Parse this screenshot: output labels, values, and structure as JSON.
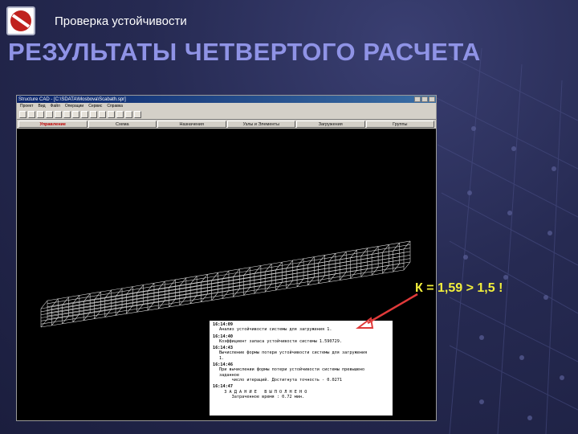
{
  "header": {
    "subtitle": "Проверка устойчивости",
    "title": "РЕЗУЛЬТАТЫ ЧЕТВЕРТОГО РАСЧЕТА"
  },
  "app": {
    "title": "Structure CAD - [C:\\SDATA\\Mosbova\\Scabath.spr]",
    "menu": [
      "Проект",
      "Вид",
      "Файл",
      "Операции",
      "Сервис",
      "Справка"
    ],
    "tabs": [
      "Управление",
      "Схема",
      "Назначения",
      "Узлы и Элементы",
      "Загружения",
      "Группы"
    ],
    "active_tab": "Управление"
  },
  "log": [
    {
      "time": "16:14:09",
      "text": "Анализ устойчивости системы для загружения 1."
    },
    {
      "time": "16:14:40",
      "text": "Коэффициент запаса устойчивости системы 1.590729."
    },
    {
      "time": "16:14:43",
      "text": "Вычисление формы потери устойчивости системы для загружения\n1."
    },
    {
      "time": "16:14:46",
      "text": "При вычислении формы потери устойчивости системы превышено\nзаданное\n     число итераций. Достигнута точность - 0.0271"
    },
    {
      "time": "16:14:47",
      "text": "  З А Д А Н И Е   В Ы П О Л Н Е Н О\n     Затраченное время : 0.72 мин."
    }
  ],
  "annotation": {
    "text": "К = 1,59 > 1,5 !"
  },
  "colors": {
    "title": "#8f93e6",
    "annotation": "#f2ef3c",
    "arrow": "#e03a3a",
    "logo": "#c0221e"
  }
}
